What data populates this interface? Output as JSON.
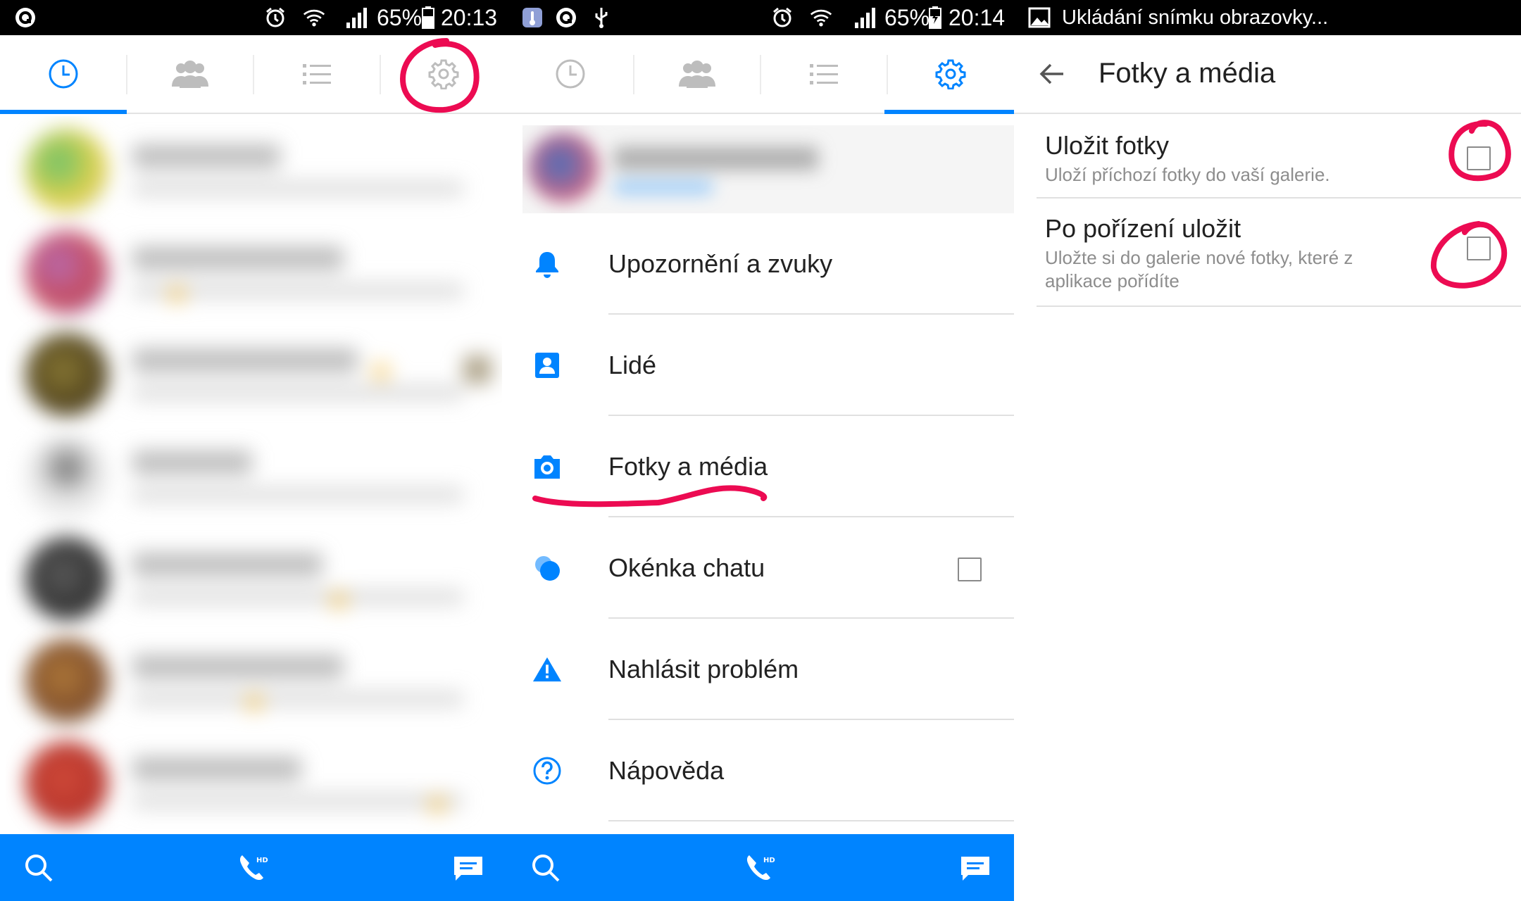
{
  "status_bar_left": {
    "time": "20:13",
    "battery": "65%"
  },
  "status_bar_mid": {
    "time": "20:14",
    "battery": "65%"
  },
  "notification": {
    "text": "Ukládání snímku obrazovky..."
  },
  "settings_menu": {
    "items": [
      {
        "label": "Upozornění a zvuky",
        "icon": "bell-icon"
      },
      {
        "label": "Lidé",
        "icon": "contact-card-icon"
      },
      {
        "label": "Fotky a média",
        "icon": "camera-icon"
      },
      {
        "label": "Okénka chatu",
        "icon": "chat-heads-icon",
        "checked": false
      },
      {
        "label": "Nahlásit problém",
        "icon": "warning-icon"
      },
      {
        "label": "Nápověda",
        "icon": "help-icon"
      }
    ]
  },
  "photos_media": {
    "title": "Fotky a média",
    "rows": [
      {
        "title": "Uložit fotky",
        "subtitle": "Uloží příchozí fotky do vaší galerie.",
        "checked": false
      },
      {
        "title": "Po pořízení uložit",
        "subtitle": "Uložte si do galerie nové fotky, které z aplikace pořídíte",
        "checked": false
      }
    ]
  },
  "colors": {
    "accent": "#0084ff",
    "annotation": "#ec0b52",
    "status_bar": "#000000"
  }
}
